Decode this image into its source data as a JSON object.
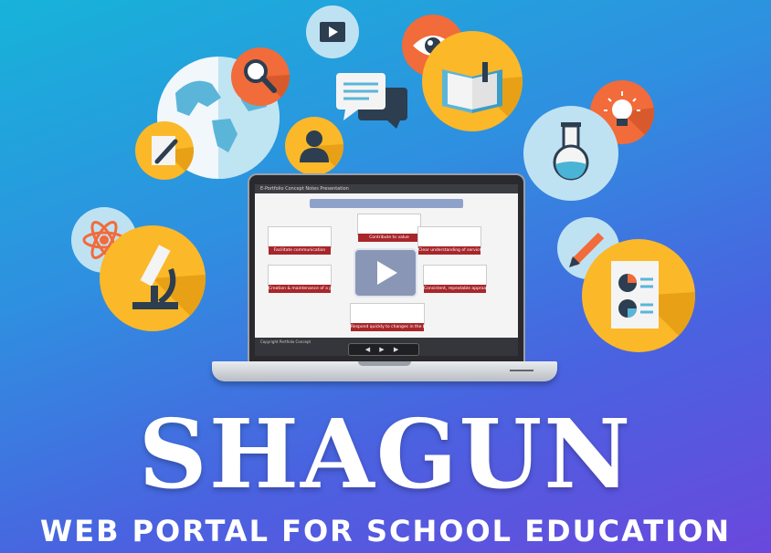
{
  "title": "SHAGUN",
  "subtitle": "WEB PORTAL FOR SCHOOL EDUCATION",
  "screen": {
    "window_title": "E-Portfolio Concept Notes Presentation",
    "nodes": [
      "Facilitate communication",
      "Contribute to value",
      "Clear understanding of service",
      "Creation & maintenance of a portfolio",
      "Consistent, repeatable approach",
      "Respond quickly to changes in the business environment"
    ],
    "footer_text": "Copyright Portfolio Concept",
    "controls": "◀ ▶ ▶"
  },
  "colors": {
    "bg_start": "#17b3d9",
    "bg_end": "#6a48dd",
    "orange": "#f26b3a",
    "yellow": "#fbb829",
    "light_blue": "#a9dcef",
    "navy": "#2c3e50"
  },
  "icons": [
    "globe-icon",
    "magnifier-icon",
    "video-icon",
    "chat-icon",
    "eye-icon",
    "book-icon",
    "lightbulb-icon",
    "flask-icon",
    "pen-icon",
    "user-icon",
    "atom-icon",
    "microscope-icon",
    "pencil-icon",
    "report-icon"
  ]
}
